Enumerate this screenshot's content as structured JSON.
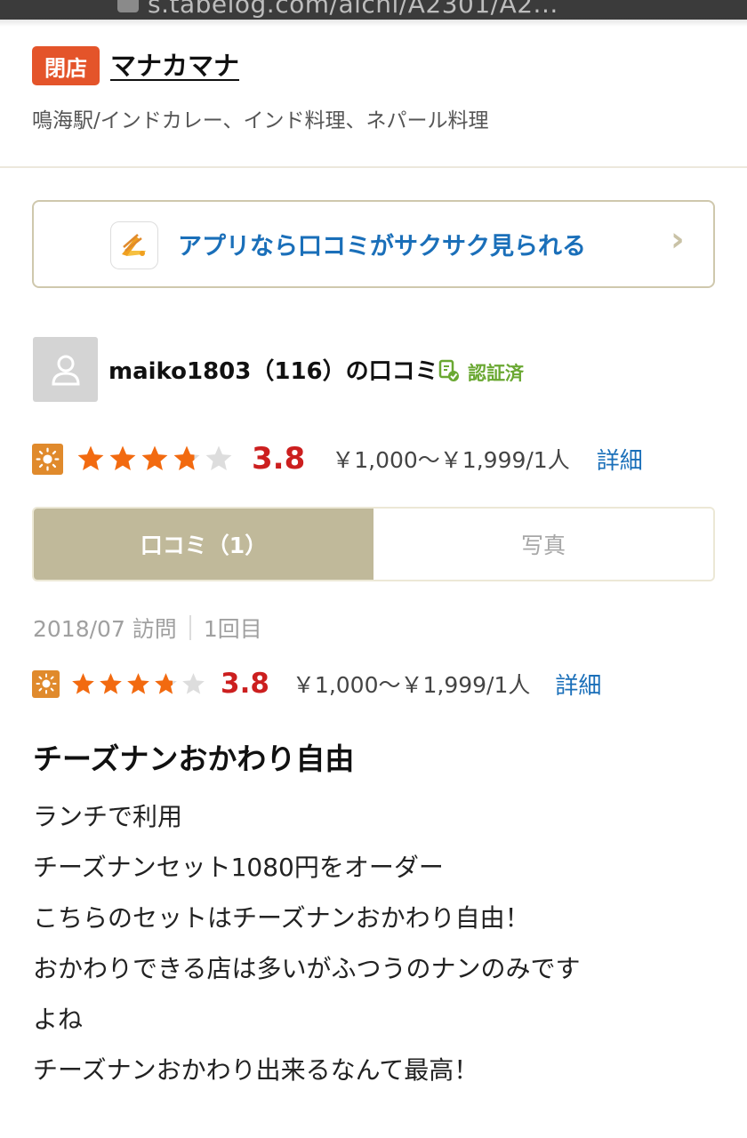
{
  "browser": {
    "url": "s.tabelog.com/aichi/A2301/A2..."
  },
  "store": {
    "closed_badge": "閉店",
    "name": "マナカマナ",
    "subtitle": "鳴海駅/インドカレー、インド料理、ネパール料理"
  },
  "app_banner": {
    "text": "アプリなら口コミがサクサク見られる",
    "chevron": "›"
  },
  "reviewer": {
    "name": "maiko1803（116）の口コミ",
    "verified": "認証済"
  },
  "summary_rating": {
    "stars": 3.8,
    "score": "3.8",
    "price": "￥1,000～￥1,999/1人",
    "detail": "詳細"
  },
  "tabs": [
    {
      "label": "口コミ（1）",
      "active": true
    },
    {
      "label": "写真",
      "active": false
    }
  ],
  "visit": {
    "date": "2018/07 訪問",
    "count": "1回目"
  },
  "review_rating": {
    "stars": 3.8,
    "score": "3.8",
    "price": "￥1,000～￥1,999/1人",
    "detail": "詳細"
  },
  "review": {
    "title": "チーズナンおかわり自由",
    "lines": [
      "ランチで利用",
      "チーズナンセット1080円をオーダー",
      "こちらのセットはチーズナンおかわり自由！",
      "おかわりできる店は多いがふつうのナンのみです",
      "よね",
      "チーズナンおかわり出来るなんて最高！"
    ]
  },
  "colors": {
    "closed_badge": "#e4542a",
    "link_blue": "#1a6fb9",
    "score_red": "#cc1f1f",
    "star_orange": "#f26a10",
    "star_empty": "#dddddd",
    "tab_active": "#c0b99a",
    "verified_green": "#6aa832",
    "sun_icon": "#e08a2c"
  },
  "icons": {
    "app": "tabelog-app-icon",
    "avatar": "user-silhouette-icon",
    "verified": "verified-check-icon",
    "rating": "daytime-sun-icon"
  }
}
